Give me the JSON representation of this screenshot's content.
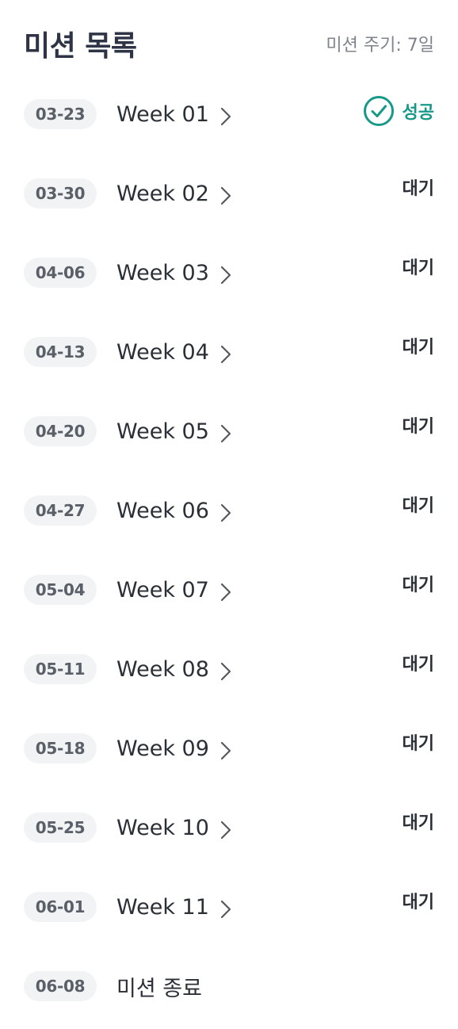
{
  "header": {
    "title": "미션 목록",
    "cycle_label": "미션 주기: 7일"
  },
  "colors": {
    "accent_success": "#17998a",
    "pill_bg": "#f1f3f5",
    "text_dark": "#2b2f36",
    "text_muted": "#7f848c"
  },
  "missions": [
    {
      "date": "03-23",
      "label": "Week 01",
      "status": "성공",
      "status_type": "success"
    },
    {
      "date": "03-30",
      "label": "Week 02",
      "status": "대기",
      "status_type": "pending"
    },
    {
      "date": "04-06",
      "label": "Week 03",
      "status": "대기",
      "status_type": "pending"
    },
    {
      "date": "04-13",
      "label": "Week 04",
      "status": "대기",
      "status_type": "pending"
    },
    {
      "date": "04-20",
      "label": "Week 05",
      "status": "대기",
      "status_type": "pending"
    },
    {
      "date": "04-27",
      "label": "Week 06",
      "status": "대기",
      "status_type": "pending"
    },
    {
      "date": "05-04",
      "label": "Week 07",
      "status": "대기",
      "status_type": "pending"
    },
    {
      "date": "05-11",
      "label": "Week 08",
      "status": "대기",
      "status_type": "pending"
    },
    {
      "date": "05-18",
      "label": "Week 09",
      "status": "대기",
      "status_type": "pending"
    },
    {
      "date": "05-25",
      "label": "Week 10",
      "status": "대기",
      "status_type": "pending"
    },
    {
      "date": "06-01",
      "label": "Week 11",
      "status": "대기",
      "status_type": "pending"
    }
  ],
  "end": {
    "date": "06-08",
    "label": "미션 종료"
  },
  "icons": {
    "chevron": "chevron-right-icon",
    "success": "check-circle-icon"
  }
}
